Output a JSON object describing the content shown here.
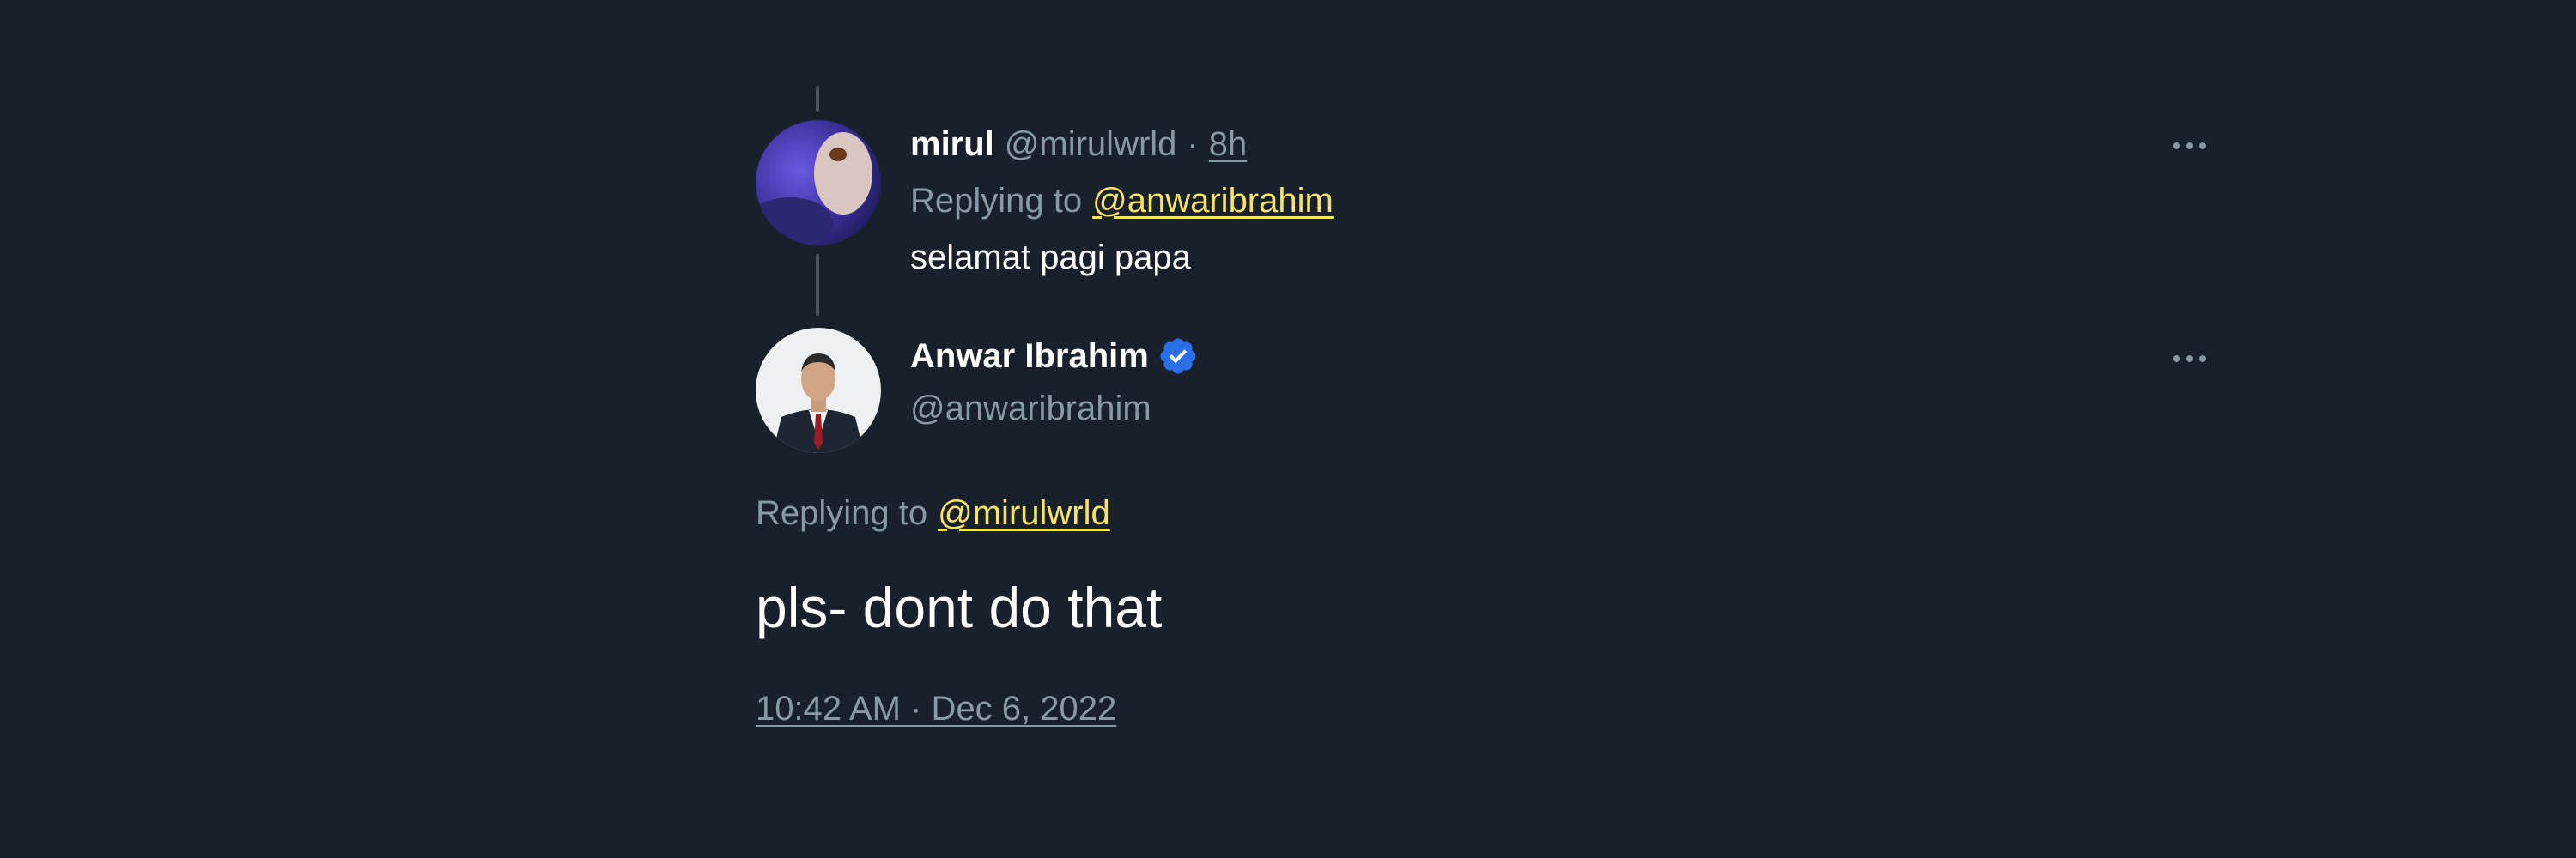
{
  "reply_tweet": {
    "display_name": "mirul",
    "handle": "@mirulwrld",
    "separator": "·",
    "time_ago": "8h",
    "replying_to_label": "Replying to",
    "replying_to_handle": "@anwaribrahim",
    "text": "selamat pagi papa"
  },
  "main_tweet": {
    "display_name": "Anwar Ibrahim",
    "verified_icon": "verified-badge-icon",
    "handle": "@anwaribrahim",
    "replying_to_label": "Replying to",
    "replying_to_handle": "@mirulwrld",
    "text": "pls- dont do that",
    "timestamp": "10:42 AM · Dec 6, 2022"
  },
  "icons": {
    "more": "more-options-icon"
  },
  "colors": {
    "background": "#17202b",
    "mention": "#fbe362",
    "muted": "#8899a6",
    "verified": "#2a6fe8"
  }
}
